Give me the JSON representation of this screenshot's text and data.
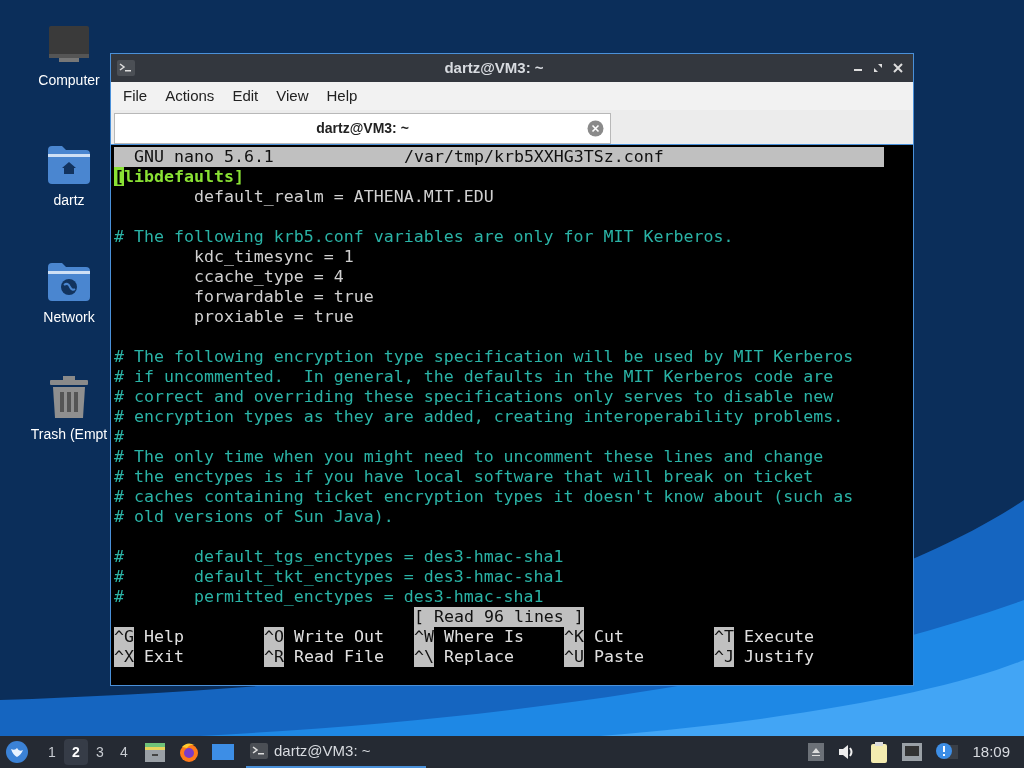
{
  "desktop_icons": [
    {
      "kind": "computer",
      "label": "Computer"
    },
    {
      "kind": "home",
      "label": "dartz"
    },
    {
      "kind": "network",
      "label": "Network"
    },
    {
      "kind": "trash",
      "label": "Trash (Empt"
    }
  ],
  "window": {
    "title": "dartz@VM3: ~",
    "menu": [
      "File",
      "Actions",
      "Edit",
      "View",
      "Help"
    ],
    "tabs": [
      {
        "label": "dartz@VM3: ~",
        "selected": true
      }
    ],
    "nano": {
      "version": "GNU nano 5.6.1",
      "file": "/var/tmp/krb5XXHG3TSz.conf",
      "lines": [
        {
          "kind": "section",
          "text": "[libdefaults]",
          "cursor": true
        },
        {
          "kind": "setting",
          "text": "        default_realm = ATHENA.MIT.EDU",
          "cursor": false
        },
        {
          "kind": "blank",
          "cursor": false
        },
        {
          "kind": "comment",
          "text": "# The following krb5.conf variables are only for MIT Kerberos.",
          "cursor": false
        },
        {
          "kind": "setting",
          "text": "        kdc_timesync = 1",
          "cursor": false
        },
        {
          "kind": "setting",
          "text": "        ccache_type = 4",
          "cursor": false
        },
        {
          "kind": "setting",
          "text": "        forwardable = true",
          "cursor": false
        },
        {
          "kind": "setting",
          "text": "        proxiable = true",
          "cursor": false
        },
        {
          "kind": "blank",
          "cursor": false
        },
        {
          "kind": "comment",
          "text": "# The following encryption type specification will be used by MIT Kerberos",
          "cursor": false
        },
        {
          "kind": "comment",
          "text": "# if uncommented.  In general, the defaults in the MIT Kerberos code are",
          "cursor": false
        },
        {
          "kind": "comment",
          "text": "# correct and overriding these specifications only serves to disable new",
          "cursor": false
        },
        {
          "kind": "comment",
          "text": "# encryption types as they are added, creating interoperability problems.",
          "cursor": false
        },
        {
          "kind": "comment",
          "text": "#",
          "cursor": false
        },
        {
          "kind": "comment",
          "text": "# The only time when you might need to uncomment these lines and change",
          "cursor": false
        },
        {
          "kind": "comment",
          "text": "# the enctypes is if you have local software that will break on ticket",
          "cursor": false
        },
        {
          "kind": "comment",
          "text": "# caches containing ticket encryption types it doesn't know about (such as",
          "cursor": false
        },
        {
          "kind": "comment",
          "text": "# old versions of Sun Java).",
          "cursor": false
        },
        {
          "kind": "blank",
          "cursor": false
        },
        {
          "kind": "commented_setting",
          "text": "#       default_tgs_enctypes = des3-hmac-sha1",
          "cursor": false
        },
        {
          "kind": "commented_setting",
          "text": "#       default_tkt_enctypes = des3-hmac-sha1",
          "cursor": false
        },
        {
          "kind": "commented_setting",
          "text": "#       permitted_enctypes = des3-hmac-sha1",
          "cursor": false
        }
      ],
      "message": "[ Read 96 lines ]",
      "shortcut_rows": [
        [
          {
            "key": "^G",
            "label": "Help"
          },
          {
            "key": "^O",
            "label": "Write Out"
          },
          {
            "key": "^W",
            "label": "Where Is"
          },
          {
            "key": "^K",
            "label": "Cut"
          },
          {
            "key": "^T",
            "label": "Execute"
          }
        ],
        [
          {
            "key": "^X",
            "label": "Exit"
          },
          {
            "key": "^R",
            "label": "Read File"
          },
          {
            "key": "^\\",
            "label": "Replace"
          },
          {
            "key": "^U",
            "label": "Paste"
          },
          {
            "key": "^J",
            "label": "Justify"
          }
        ]
      ]
    }
  },
  "taskbar": {
    "workspaces": [
      {
        "label": "1",
        "selected": false
      },
      {
        "label": "2",
        "selected": true
      },
      {
        "label": "3",
        "selected": false
      },
      {
        "label": "4",
        "selected": false
      }
    ],
    "task": "dartz@VM3: ~",
    "clock": "18:09"
  }
}
